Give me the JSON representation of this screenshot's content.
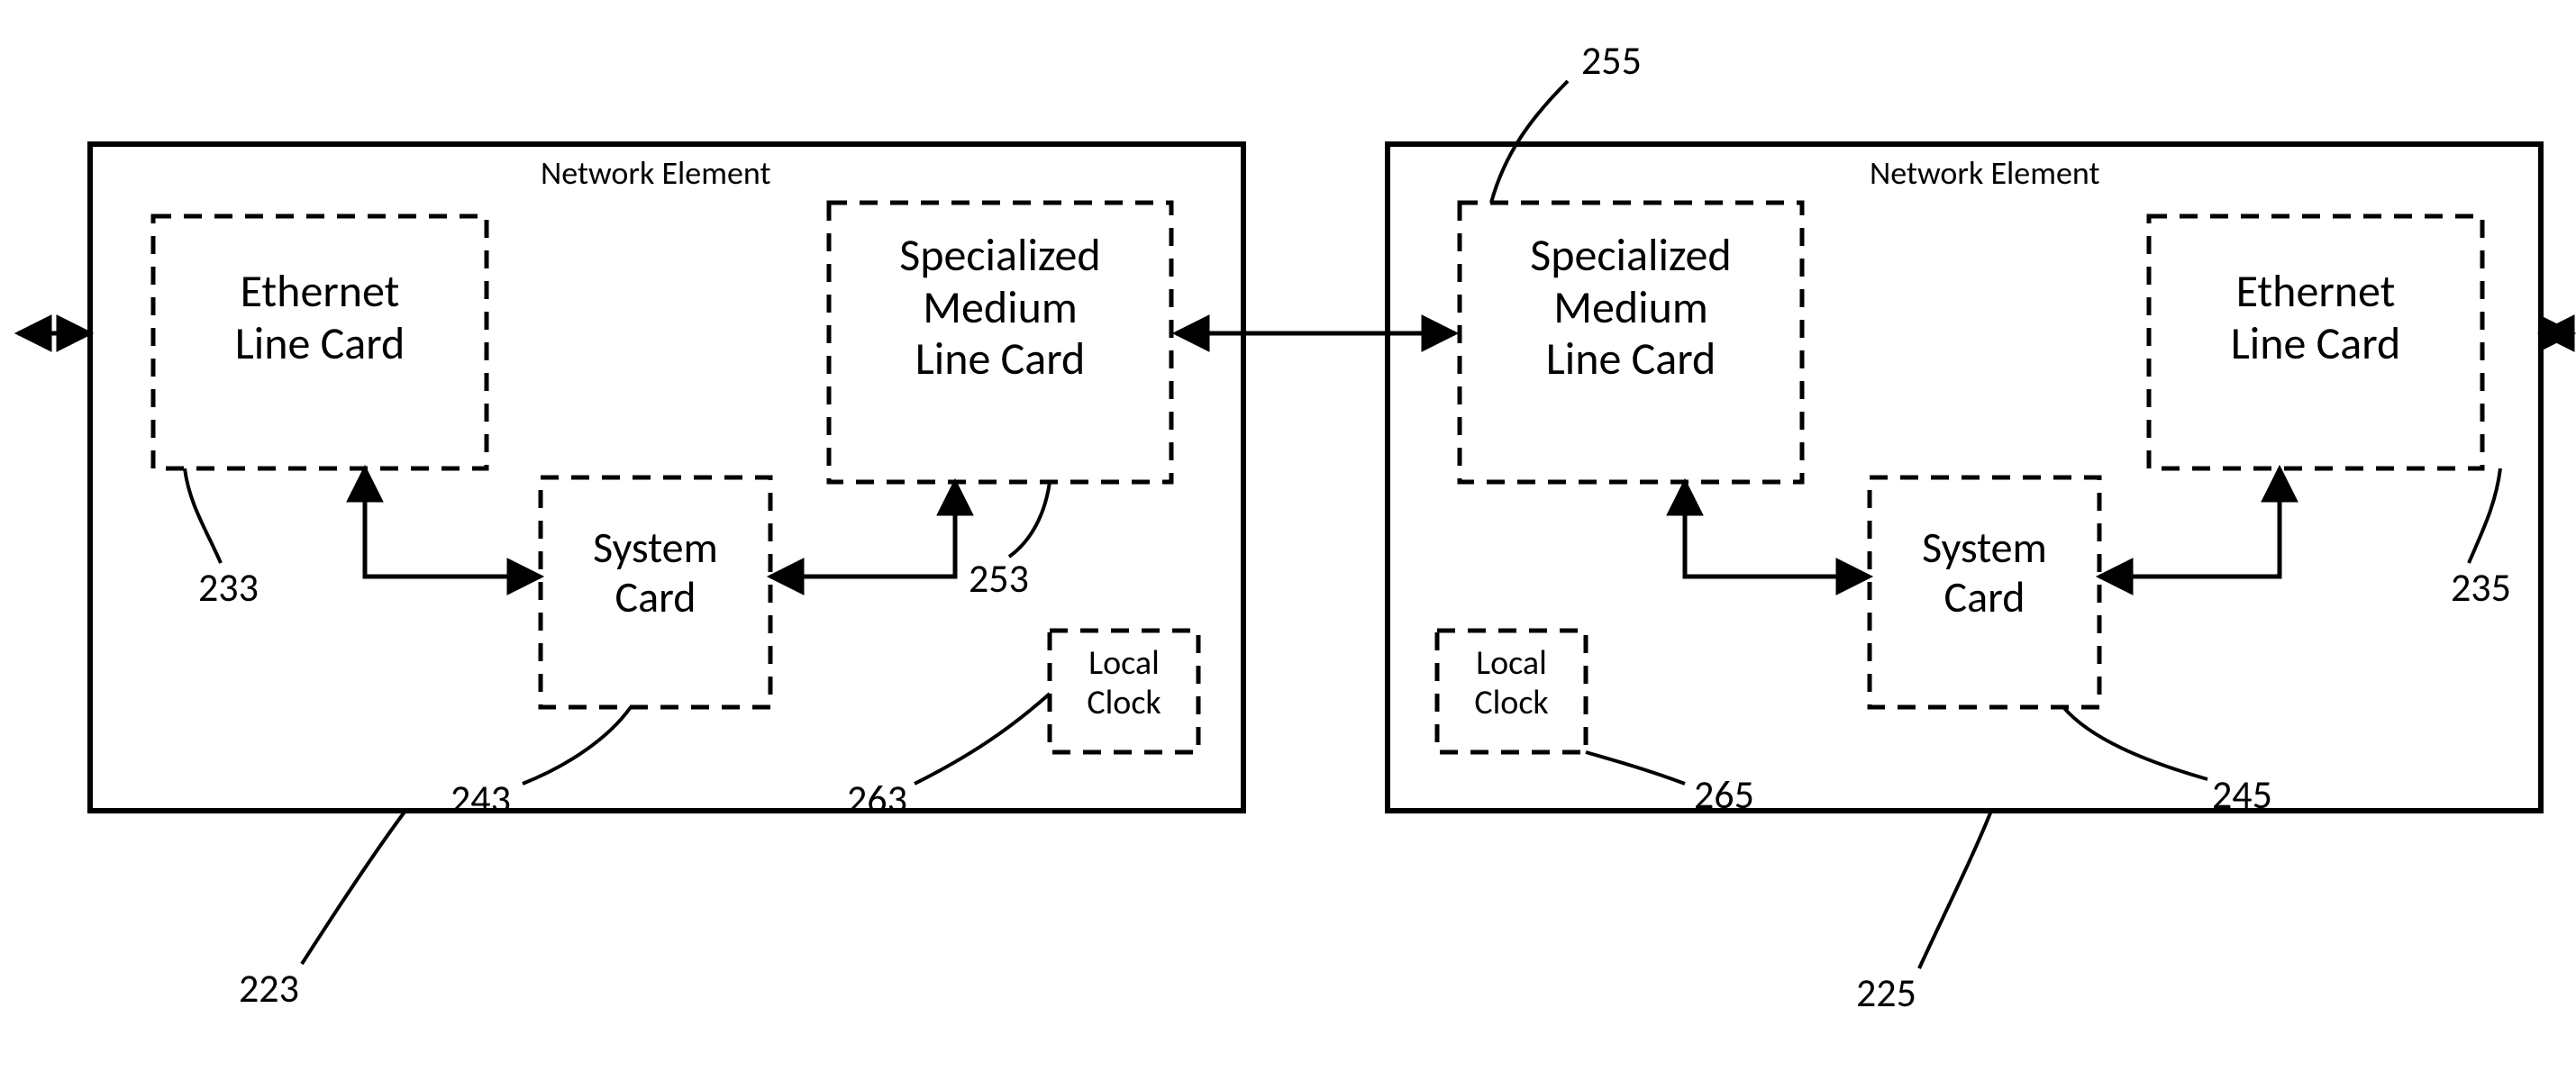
{
  "left": {
    "title": "Network Element",
    "ethernet": "Ethernet\nLine Card",
    "specialized": "Specialized\nMedium\nLine Card",
    "system": "System\nCard",
    "clock": "Local\nClock"
  },
  "right": {
    "title": "Network Element",
    "specialized": "Specialized\nMedium\nLine Card",
    "ethernet": "Ethernet\nLine Card",
    "system": "System\nCard",
    "clock": "Local\nClock"
  },
  "refs": {
    "r223": "223",
    "r233": "233",
    "r243": "243",
    "r253": "253",
    "r263": "263",
    "r225": "225",
    "r235": "235",
    "r245": "245",
    "r255": "255",
    "r265": "265"
  }
}
